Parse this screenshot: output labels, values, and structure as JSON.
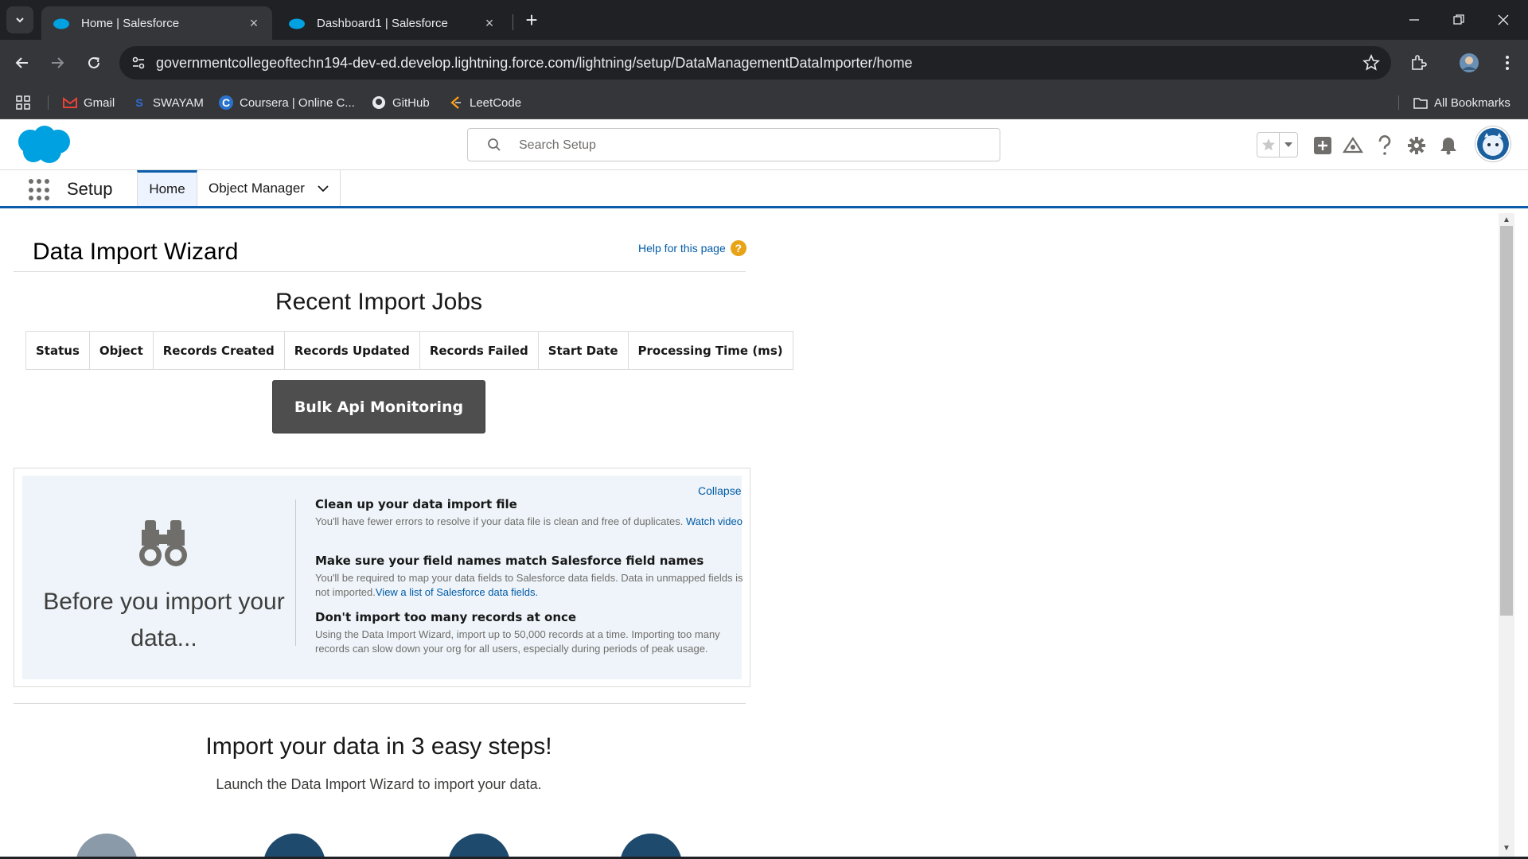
{
  "browser": {
    "tabs": [
      {
        "title": "Home | Salesforce",
        "active": true
      },
      {
        "title": "Dashboard1 | Salesforce",
        "active": false
      }
    ],
    "url": "governmentcollegeoftechn194-dev-ed.develop.lightning.force.com/lightning/setup/DataManagementDataImporter/home",
    "bookmarks": [
      "Gmail",
      "SWAYAM",
      "Coursera | Online C...",
      "GitHub",
      "LeetCode"
    ],
    "all_bookmarks": "All Bookmarks"
  },
  "sf": {
    "search_placeholder": "Search Setup",
    "app_name": "Setup",
    "nav_tabs": {
      "home": "Home",
      "object_manager": "Object Manager"
    }
  },
  "page": {
    "title": "Data Import Wizard",
    "help_link": "Help for this page",
    "help_icon": "?",
    "recent_jobs_title": "Recent Import Jobs",
    "table_headers": [
      "Status",
      "Object",
      "Records Created",
      "Records Updated",
      "Records Failed",
      "Start Date",
      "Processing Time (ms)"
    ],
    "bulk_button": "Bulk Api Monitoring",
    "tips": {
      "collapse": "Collapse",
      "heading": "Before you import your data...",
      "items": [
        {
          "title": "Clean up your data import file",
          "body": "You'll have fewer errors to resolve if your data file is clean and free of duplicates.",
          "link": "Watch video"
        },
        {
          "title": "Make sure your field names match Salesforce field names",
          "body": "You'll be required to map your data fields to Salesforce data fields. Data in unmapped fields is not imported.",
          "link": "View a list of Salesforce data fields."
        },
        {
          "title": "Don't import too many records at once",
          "body": "Using the Data Import Wizard, import up to 50,000 records at a time. Importing too many records can slow down your org for all users, especially during periods of peak usage.",
          "link": ""
        }
      ]
    },
    "steps_title": "Import your data in 3 easy steps!",
    "steps_subtitle": "Launch the Data Import Wizard to import your data."
  },
  "colors": {
    "brand": "#00a1e0",
    "accent": "#0b5cab",
    "button_dark": "#4e4e4e",
    "help_orange": "#e8a317"
  }
}
